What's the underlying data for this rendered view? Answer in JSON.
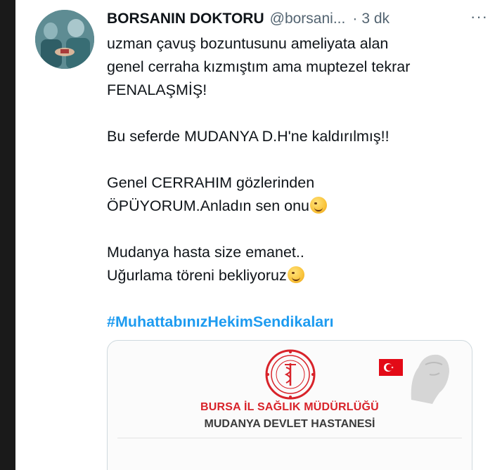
{
  "tweet": {
    "author_name": "BORSANIN DOKTORU",
    "author_handle": "@borsani...",
    "separator": "·",
    "time": "3 dk",
    "lines": {
      "l1": "uzman çavuş bozuntusunu ameliyata alan",
      "l2": "genel cerraha kızmıştım ama  muptezel tekrar",
      "l3": "FENALAŞMİŞ!",
      "l4": "Bu seferde MUDANYA D.H'ne kaldırılmış!!",
      "l5": "Genel CERRAHIM gözlerinden",
      "l6": "ÖPÜYORUM.Anladın sen onu",
      "l7": "Mudanya hasta size emanet..",
      "l8": "Uğurlama töreni bekliyoruz"
    },
    "hashtag": "#MuhattabınızHekimSendikaları"
  },
  "media": {
    "title_line1": "BURSA İL SAĞLIK MÜDÜRLÜĞÜ",
    "title_line2": "MUDANYA DEVLET HASTANESİ",
    "accent_red": "#d8232a"
  },
  "colors": {
    "text": "#0f1419",
    "muted": "#536471",
    "link": "#1d9bf0"
  }
}
